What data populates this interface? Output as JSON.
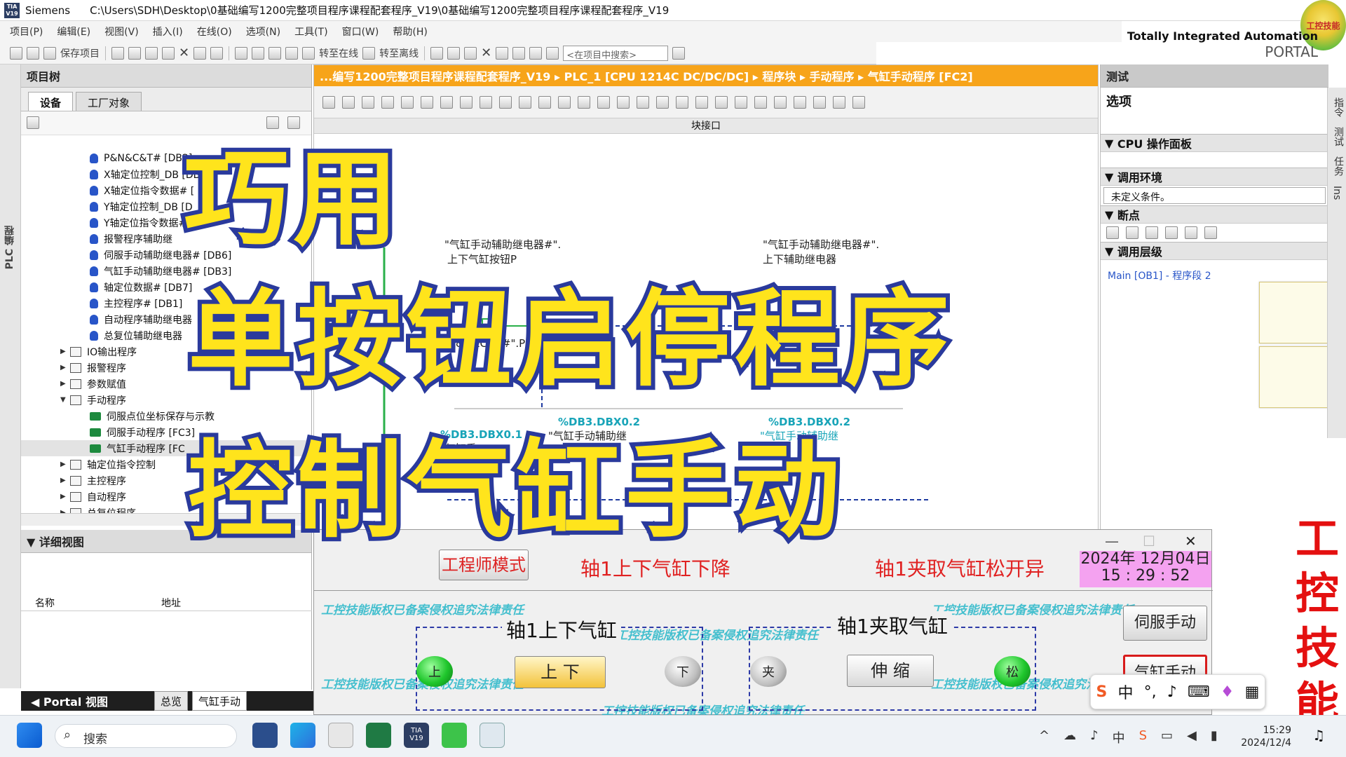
{
  "titlebar": {
    "app": "Siemens",
    "path": "C:\\Users\\SDH\\Desktop\\0基础编写1200完整项目程序课程配套程序_V19\\0基础编写1200完整项目程序课程配套程序_V19",
    "logo_text": "TIA V19"
  },
  "menu": [
    "项目(P)",
    "编辑(E)",
    "视图(V)",
    "插入(I)",
    "在线(O)",
    "选项(N)",
    "工具(T)",
    "窗口(W)",
    "帮助(H)"
  ],
  "toolbar": {
    "save": "保存项目",
    "go_online": "转至在线",
    "go_offline": "转至离线",
    "search_placeholder": "<在项目中搜索>"
  },
  "brand": {
    "title": "Totally Integrated Automation",
    "subtitle": "PORTAL",
    "logo": "工控技能"
  },
  "left_strip": "PLC 编程",
  "project_tree": {
    "title": "项目树",
    "tabs": [
      "设备",
      "工厂对象"
    ],
    "items": [
      {
        "label": "P&N&C&T# [DB2]",
        "type": "db",
        "indent": 3
      },
      {
        "label": "X轴定位控制_DB [DB",
        "type": "db",
        "indent": 3
      },
      {
        "label": "X轴定位指令数据# [",
        "type": "db",
        "indent": 3
      },
      {
        "label": "Y轴定位控制_DB [D",
        "type": "db",
        "indent": 3
      },
      {
        "label": "Y轴定位指令数据# [",
        "type": "db",
        "indent": 3
      },
      {
        "label": "报警程序辅助继",
        "type": "db",
        "indent": 3
      },
      {
        "label": "伺服手动辅助继电器# [DB6]",
        "type": "db",
        "indent": 3
      },
      {
        "label": "气缸手动辅助继电器# [DB3]",
        "type": "db",
        "indent": 3
      },
      {
        "label": "轴定位数据# [DB7]",
        "type": "db",
        "indent": 3
      },
      {
        "label": "主控程序# [DB1]",
        "type": "db",
        "indent": 3
      },
      {
        "label": "自动程序辅助继电器",
        "type": "db",
        "indent": 3
      },
      {
        "label": "总复位辅助继电器",
        "type": "db",
        "indent": 3
      },
      {
        "label": "IO输出程序",
        "type": "folder",
        "indent": 2,
        "arrow": "▶"
      },
      {
        "label": "报警程序",
        "type": "folder",
        "indent": 2,
        "arrow": "▶"
      },
      {
        "label": "参数赋值",
        "type": "folder",
        "indent": 2,
        "arrow": "▶"
      },
      {
        "label": "手动程序",
        "type": "folder",
        "indent": 2,
        "arrow": "▼"
      },
      {
        "label": "伺服点位坐标保存与示教",
        "type": "fc",
        "indent": 3
      },
      {
        "label": "伺服手动程序 [FC3]",
        "type": "fc",
        "indent": 3
      },
      {
        "label": "气缸手动程序 [FC",
        "type": "fc",
        "indent": 3,
        "selected": true
      },
      {
        "label": "轴定位指令控制",
        "type": "folder",
        "indent": 2,
        "arrow": "▶"
      },
      {
        "label": "主控程序",
        "type": "folder",
        "indent": 2,
        "arrow": "▶"
      },
      {
        "label": "自动程序",
        "type": "folder",
        "indent": 2,
        "arrow": "▶"
      },
      {
        "label": "总复位程序",
        "type": "folder",
        "indent": 2,
        "arrow": "▶"
      }
    ]
  },
  "detail_view": {
    "title": "详细视图",
    "col_name": "名称",
    "col_address": "地址"
  },
  "editor": {
    "breadcrumb": "...编写1200完整项目程序课程配套程序_V19 ▸ PLC_1 [CPU 1214C DC/DC/DC] ▸ 程序块 ▸ 手动程序 ▸ 气缸手动程序 [FC2]",
    "block_interface": "块接口",
    "contact1_db": "\"气缸手动辅助继电器#\".",
    "contact1_name": "上下气缸按钮P",
    "coil1_db": "\"气缸手动辅助继电器#\".",
    "coil1_name": "上下辅助继电器",
    "p_label": "P",
    "pnc_label": "\"P&N&C&T#\".P[3]",
    "addr_a": "%DB3.DBX0.1",
    "addr_b": "%DB3.DBX0.2",
    "addr_c": "%DB3.DBX0.2",
    "addr_b_text": "\"气缸手动辅助继",
    "addr_c_text": "\"气缸手动辅助继",
    "addr_a_text": "\"气缸手",
    "frag_qi": "器"
  },
  "test_panel": {
    "title": "测试",
    "options": "选项",
    "cpu_panel": "CPU 操作面板",
    "env": "调用环境",
    "env_value": "未定义条件。",
    "breakpoints": "断点",
    "call_hierarchy": "调用层级",
    "call_item": "Main [OB1] - 程序段 2"
  },
  "right_strip": [
    "指令",
    "测试",
    "任务",
    "Ins"
  ],
  "hmi": {
    "engineer_mode": "工程师模式",
    "marquee_left": "轴1上下气缸下降",
    "marquee_right": "轴1夹取气缸松开异",
    "date": "2024年 12月04日",
    "time": "15 : 29 : 52",
    "group1_title": "轴1上下气缸",
    "group1_button": "上  下",
    "group1_led_up": "上",
    "group1_led_down": "下",
    "group2_title": "轴1夹取气缸",
    "group2_button": "伸  缩",
    "group2_led_clamp": "夹",
    "group2_led_release": "松",
    "servo_manual": "伺服手动",
    "cylinder_manual": "气缸手动",
    "watermark": "工控技能版权已备案侵权追究法律责任",
    "win_min": "—",
    "win_max": "☐",
    "win_close": "✕"
  },
  "overlay": {
    "line1": "巧用",
    "line2": "单按钮启停程序",
    "line3": "控制气缸手动"
  },
  "vertical_brand": [
    "工",
    "控",
    "技",
    "能"
  ],
  "bottom": {
    "portal_view": "◀ Portal 视图",
    "overview": "总览",
    "fc_tab": "气缸手动"
  },
  "ime": {
    "lang": "中",
    "punct": "°,"
  },
  "taskbar": {
    "search": "搜索",
    "time": "15:29",
    "date": "2024/12/4"
  },
  "colors": {
    "editor_title": "#f7a41a",
    "overlay_fill": "#ffe41c",
    "overlay_stroke": "#2a3a9c",
    "brand_red": "#e41010",
    "datetime_bg": "#f4a2f0"
  }
}
